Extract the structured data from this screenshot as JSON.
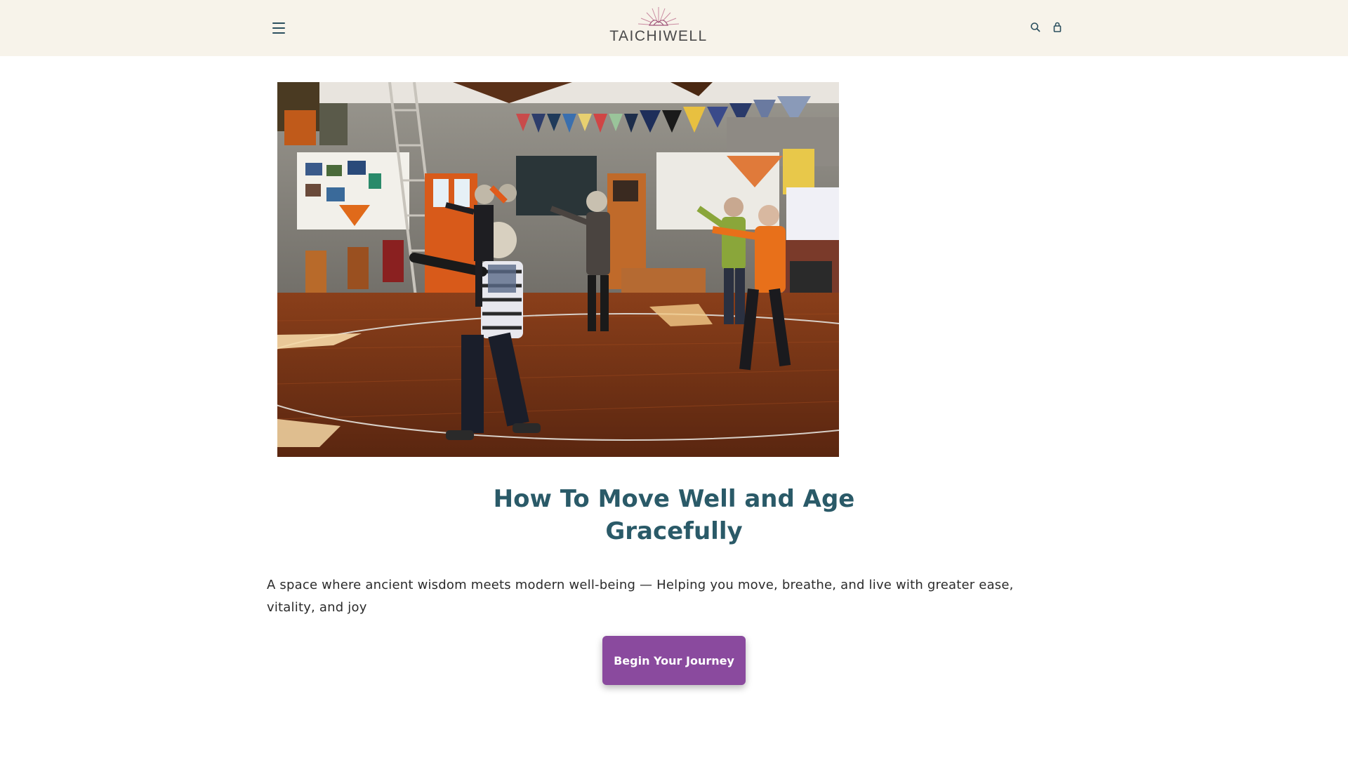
{
  "header": {
    "logo_text": "TAICHIWELL",
    "menu_icon": "hamburger-menu-icon",
    "search_icon": "search-icon",
    "cart_icon": "shopping-bag-icon",
    "background": "#f7f3ea"
  },
  "hero": {
    "image_description_icon": "tai-chi-class-photo"
  },
  "main": {
    "title": "How To Move Well and Age Gracefully",
    "tagline": "A space where ancient wisdom meets modern well-being — Helping you move, breathe, and live with greater ease, vitality, and joy",
    "cta_label": "Begin Your Journey"
  },
  "colors": {
    "title": "#2a5a68",
    "cta_background": "#8a4a9e",
    "text": "#2b2b2b"
  }
}
